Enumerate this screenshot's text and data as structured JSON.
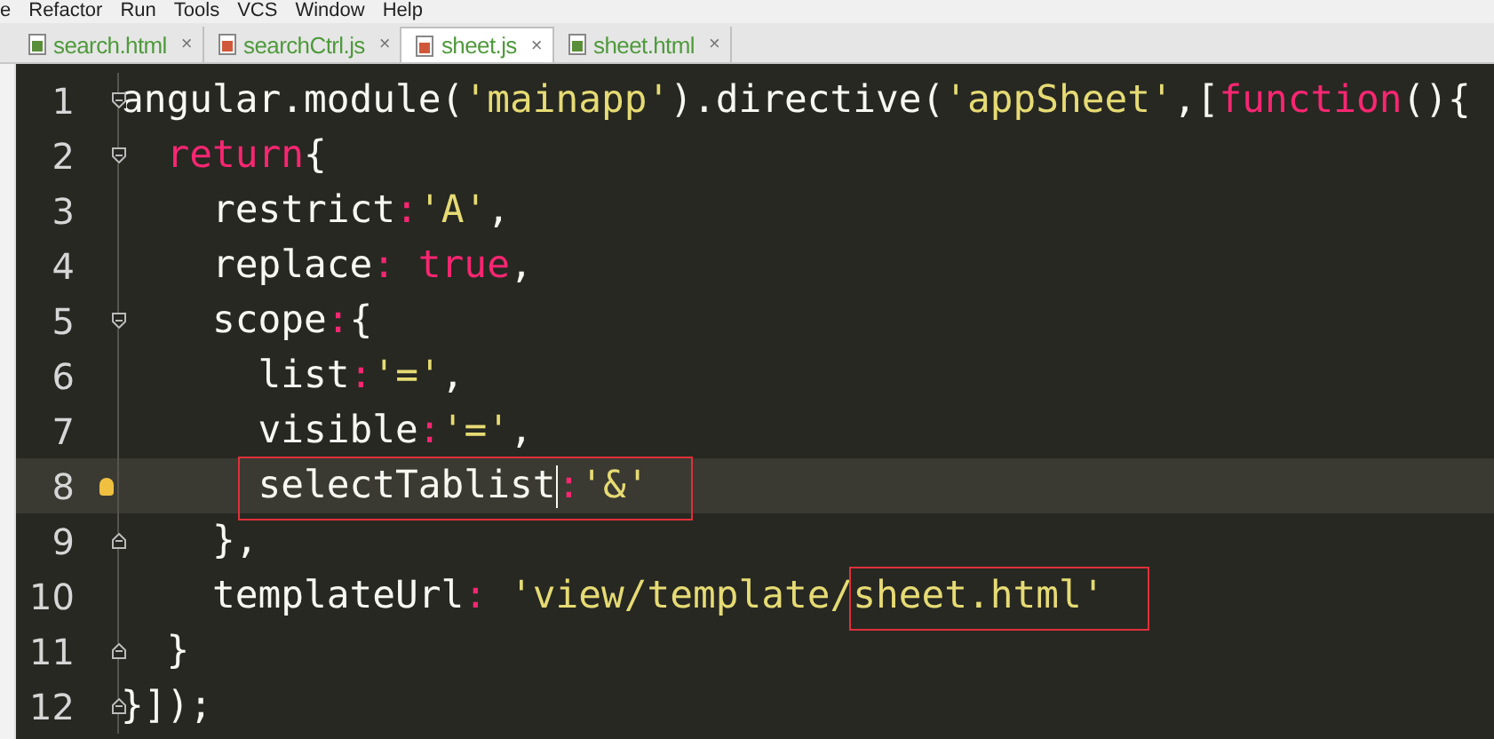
{
  "menu": [
    "e",
    "Refactor",
    "Run",
    "Tools",
    "VCS",
    "Window",
    "Help"
  ],
  "tabs": [
    {
      "label": "search.html",
      "kind": "html",
      "selected": false
    },
    {
      "label": "searchCtrl.js",
      "kind": "js",
      "selected": false
    },
    {
      "label": "sheet.js",
      "kind": "js",
      "selected": true
    },
    {
      "label": "sheet.html",
      "kind": "html",
      "selected": false
    }
  ],
  "close_mark": "×",
  "lines": [
    {
      "number": "1",
      "fold_start": true,
      "tokens": [
        {
          "kind": "plain",
          "text": "angular.module("
        },
        {
          "kind": "string",
          "text": "'mainapp'"
        },
        {
          "kind": "plain",
          "text": ").directive("
        },
        {
          "kind": "string",
          "text": "'appSheet'"
        },
        {
          "kind": "plain",
          "text": ",["
        },
        {
          "kind": "keyword",
          "text": "function"
        },
        {
          "kind": "plain",
          "text": "(){"
        }
      ]
    },
    {
      "number": "2",
      "fold_start": true,
      "tokens": [
        {
          "kind": "keyword",
          "text": "  return"
        },
        {
          "kind": "plain",
          "text": "{"
        }
      ]
    },
    {
      "number": "3",
      "tokens": [
        {
          "kind": "plain",
          "text": "    restrict"
        },
        {
          "kind": "keyword",
          "text": ":"
        },
        {
          "kind": "string",
          "text": "'A'"
        },
        {
          "kind": "plain",
          "text": ","
        }
      ]
    },
    {
      "number": "4",
      "tokens": [
        {
          "kind": "plain",
          "text": "    replace"
        },
        {
          "kind": "keyword",
          "text": ": true"
        },
        {
          "kind": "plain",
          "text": ","
        }
      ]
    },
    {
      "number": "5",
      "fold_start": true,
      "tokens": [
        {
          "kind": "plain",
          "text": "    scope"
        },
        {
          "kind": "keyword",
          "text": ":"
        },
        {
          "kind": "plain",
          "text": "{"
        }
      ]
    },
    {
      "number": "6",
      "tokens": [
        {
          "kind": "plain",
          "text": "      list"
        },
        {
          "kind": "keyword",
          "text": ":"
        },
        {
          "kind": "string",
          "text": "'='"
        },
        {
          "kind": "plain",
          "text": ","
        }
      ]
    },
    {
      "number": "7",
      "tokens": [
        {
          "kind": "plain",
          "text": "      visible"
        },
        {
          "kind": "keyword",
          "text": ":"
        },
        {
          "kind": "string",
          "text": "'='"
        },
        {
          "kind": "plain",
          "text": ","
        }
      ]
    },
    {
      "number": "8",
      "current": true,
      "bulb": true,
      "tokens": [
        {
          "kind": "plain",
          "text": "      selectTablist",
          "boxed": true,
          "caret": true
        },
        {
          "kind": "keyword",
          "text": ":",
          "boxed": true
        },
        {
          "kind": "string",
          "text": "'&'",
          "boxed": true
        }
      ]
    },
    {
      "number": "9",
      "fold_end": true,
      "tokens": [
        {
          "kind": "plain",
          "text": "    },"
        }
      ]
    },
    {
      "number": "10",
      "tokens": [
        {
          "kind": "plain",
          "text": "    templateUrl"
        },
        {
          "kind": "keyword",
          "text": ":"
        },
        {
          "kind": "string",
          "text": " 'view/template/"
        },
        {
          "kind": "string",
          "text": "sheet.html'",
          "boxed": true
        }
      ]
    },
    {
      "number": "11",
      "fold_end": true,
      "tokens": [
        {
          "kind": "plain",
          "text": "  }"
        }
      ]
    },
    {
      "number": "12",
      "fold_end": true,
      "tokens": [
        {
          "kind": "plain",
          "text": "}]);"
        }
      ]
    }
  ]
}
